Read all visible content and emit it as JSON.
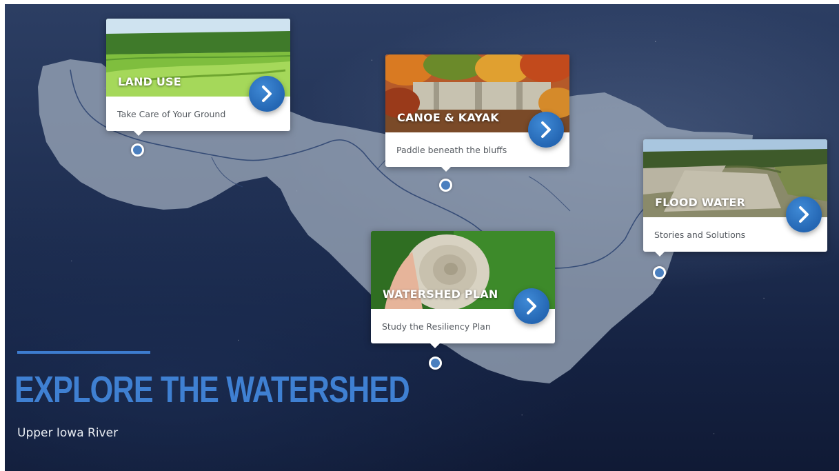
{
  "hero": {
    "title": "EXPLORE THE WATERSHED",
    "subtitle": "Upper Iowa River"
  },
  "cards": [
    {
      "title": "LAND USE",
      "subtitle": "Take Care of Your Ground",
      "image": "farm-fields-photo",
      "button_icon": "chevron-right-icon"
    },
    {
      "title": "CANOE & KAYAK",
      "subtitle": "Paddle beneath the bluffs",
      "image": "autumn-bluffs-photo",
      "button_icon": "chevron-right-icon"
    },
    {
      "title": "FLOOD WATER",
      "subtitle": "Stories and Solutions",
      "image": "flood-debris-photo",
      "button_icon": "chevron-right-icon"
    },
    {
      "title": "WATERSHED PLAN",
      "subtitle": "Study the Resiliency Plan",
      "image": "fossil-shell-photo",
      "button_icon": "chevron-right-icon"
    }
  ],
  "colors": {
    "accent": "#3f80d2",
    "button": "#2a6cb8",
    "background": "#1f2f52",
    "pin": "#4a7fbf"
  }
}
